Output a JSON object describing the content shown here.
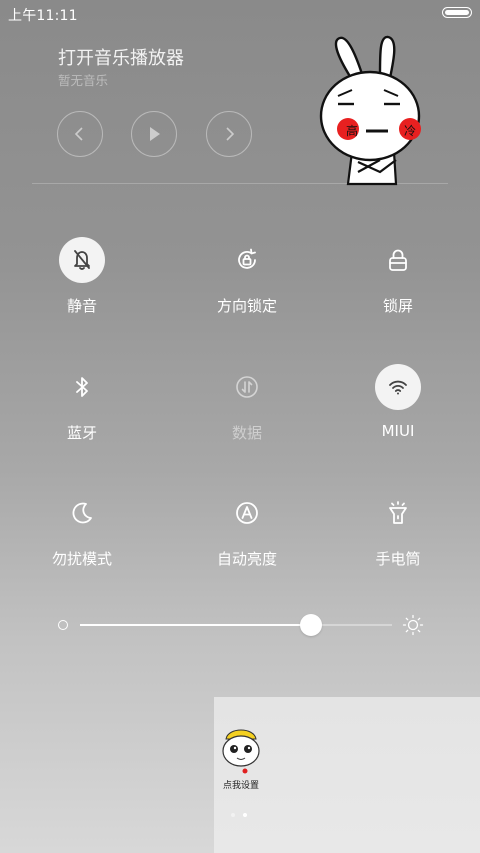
{
  "status_bar": {
    "time": "上午11:11"
  },
  "music": {
    "title": "打开音乐播放器",
    "subtitle": "暂无音乐",
    "controls": [
      "previous",
      "play",
      "next"
    ]
  },
  "sticker": {
    "cheek_left": "高",
    "cheek_right": "冷",
    "label": "点我设置"
  },
  "toggles": [
    {
      "label": "静音",
      "icon": "bell-off-icon",
      "active": true
    },
    {
      "label": "方向锁定",
      "icon": "rotation-lock-icon",
      "active": false
    },
    {
      "label": "锁屏",
      "icon": "lock-icon",
      "active": false
    },
    {
      "label": "蓝牙",
      "icon": "bluetooth-icon",
      "active": false
    },
    {
      "label": "数据",
      "icon": "mobile-data-icon",
      "active": false,
      "disabled": true
    },
    {
      "label": "MIUI",
      "icon": "wifi-icon",
      "active": true
    },
    {
      "label": "勿扰模式",
      "icon": "moon-icon",
      "active": false
    },
    {
      "label": "自动亮度",
      "icon": "auto-brightness-icon",
      "active": false
    },
    {
      "label": "手电筒",
      "icon": "flashlight-icon",
      "active": false
    }
  ],
  "brightness": {
    "level": 0.74
  },
  "pager": {
    "pages": 2,
    "current": 2
  },
  "colors": {
    "accent_on": "#f3f3f3",
    "cheek": "#e82020"
  }
}
